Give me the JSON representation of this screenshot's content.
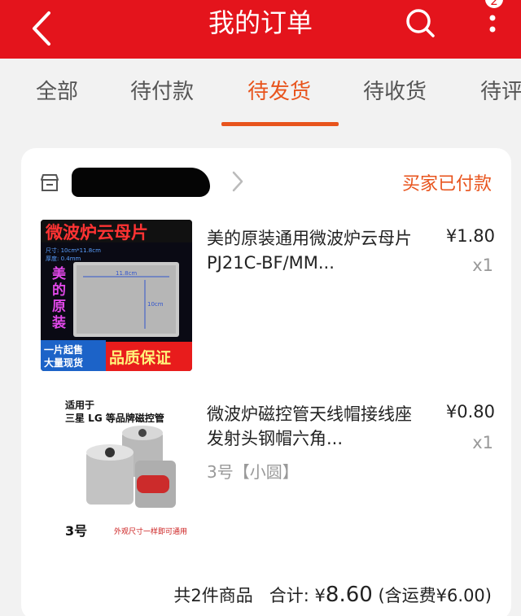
{
  "header": {
    "title": "我的订单",
    "badge": "2"
  },
  "tabs": [
    {
      "label": "全部"
    },
    {
      "label": "待付款"
    },
    {
      "label": "待发货"
    },
    {
      "label": "待收货"
    },
    {
      "label": "待评价"
    }
  ],
  "order": {
    "shop_name": "",
    "status": "买家已付款",
    "items": [
      {
        "name": "美的原装通用微波炉云母片PJ21C-BF/MM...",
        "price": "¥1.80",
        "qty": "x1",
        "image_text": {
          "headline": "微波炉云母片",
          "size_label": "尺寸: 10cm*11.8cm",
          "thickness_label": "厚度: 0.4mm",
          "brand_lines": [
            "美",
            "的",
            "原",
            "装"
          ],
          "dim_w": "11.8cm",
          "dim_h": "10cm",
          "promo_left_1": "一片起售",
          "promo_left_2": "大量现货",
          "promo_right": "品质保证"
        }
      },
      {
        "name": "微波炉磁控管天线帽接线座 发射头钢帽六角...",
        "variant": "3号【小圆】",
        "price": "¥0.80",
        "qty": "x1",
        "image_text": {
          "top_line_1": "适用于",
          "top_line_2": "三星 LG 等品牌磁控管",
          "size_label": "3号",
          "bottom_note": "外观尺寸一样即可通用"
        }
      }
    ],
    "summary": {
      "count_text": "共2件商品",
      "total_label": "合计:",
      "currency": "¥",
      "total_value": "8.60",
      "shipping_text": "(含运费¥6.00)"
    }
  },
  "colors": {
    "header_bg": "#e4141c",
    "accent": "#e8541d"
  }
}
